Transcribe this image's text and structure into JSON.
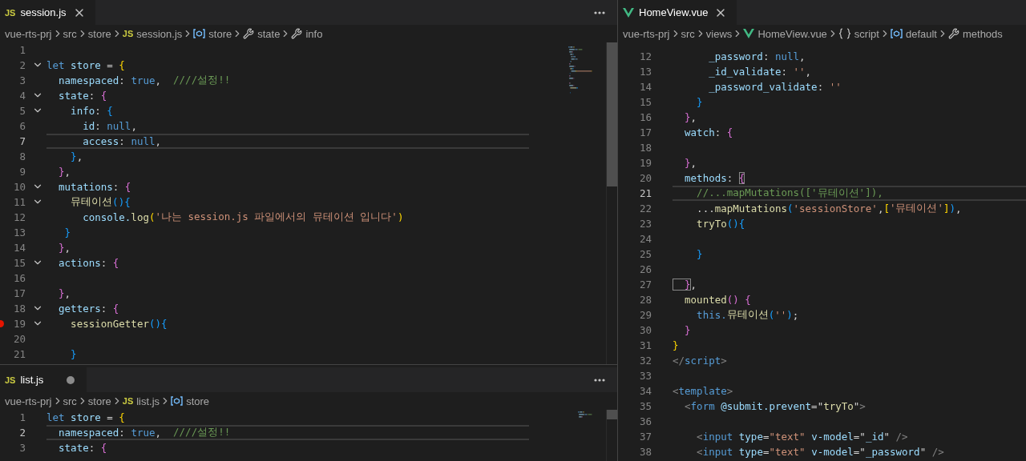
{
  "left_group": {
    "editors": [
      {
        "tab": {
          "label": "session.js",
          "kind": "js_file",
          "icon_text": "JS",
          "modified": false
        },
        "actions_menu": true,
        "minimap": true,
        "breadcrumbs": [
          {
            "label": "vue-rts-prj",
            "kind": "folder"
          },
          {
            "label": "src",
            "kind": "folder"
          },
          {
            "label": "store",
            "kind": "folder"
          },
          {
            "label": "session.js",
            "kind": "js_file",
            "icon_text": "JS"
          },
          {
            "label": "store",
            "kind": "variable"
          },
          {
            "label": "state",
            "kind": "property"
          },
          {
            "label": "info",
            "kind": "property"
          }
        ],
        "lines": [
          {
            "n": "1",
            "current": false,
            "fold": false,
            "breakpoint": false
          },
          {
            "n": "2",
            "current": false,
            "fold": true,
            "breakpoint": false,
            "tokens": [
              {
                "kind": "keyword",
                "text": "let"
              },
              {
                "kind": "variable",
                "text": " store"
              },
              {
                "kind": "punctuation",
                "text": " = "
              },
              {
                "kind": "brace1",
                "text": "{"
              }
            ]
          },
          {
            "n": "3",
            "current": false,
            "fold": false,
            "breakpoint": false,
            "tokens": [
              {
                "kind": "variable",
                "text": "  namespaced"
              },
              {
                "kind": "punctuation",
                "text": ": "
              },
              {
                "kind": "keyword",
                "text": "true"
              },
              {
                "kind": "punctuation",
                "text": ",  "
              },
              {
                "kind": "comment",
                "text": "////설정!!"
              }
            ]
          },
          {
            "n": "4",
            "current": false,
            "fold": true,
            "breakpoint": false,
            "tokens": [
              {
                "kind": "variable",
                "text": "  state"
              },
              {
                "kind": "punctuation",
                "text": ": "
              },
              {
                "kind": "brace2",
                "text": "{"
              }
            ]
          },
          {
            "n": "5",
            "current": false,
            "fold": true,
            "breakpoint": false,
            "tokens": [
              {
                "kind": "variable",
                "text": "    info"
              },
              {
                "kind": "punctuation",
                "text": ": "
              },
              {
                "kind": "brace3",
                "text": "{"
              }
            ]
          },
          {
            "n": "6",
            "current": false,
            "fold": false,
            "breakpoint": false,
            "tokens": [
              {
                "kind": "variable",
                "text": "      id"
              },
              {
                "kind": "punctuation",
                "text": ": "
              },
              {
                "kind": "keyword",
                "text": "null"
              },
              {
                "kind": "punctuation",
                "text": ","
              }
            ]
          },
          {
            "n": "7",
            "current": true,
            "fold": false,
            "breakpoint": false,
            "tokens": [
              {
                "kind": "variable",
                "text": "      access"
              },
              {
                "kind": "punctuation",
                "text": ": "
              },
              {
                "kind": "keyword",
                "text": "null"
              },
              {
                "kind": "punctuation",
                "text": ","
              }
            ]
          },
          {
            "n": "8",
            "current": false,
            "fold": false,
            "breakpoint": false,
            "tokens": [
              {
                "kind": "brace3",
                "text": "    }"
              },
              {
                "kind": "punctuation",
                "text": ","
              }
            ]
          },
          {
            "n": "9",
            "current": false,
            "fold": false,
            "breakpoint": false,
            "tokens": [
              {
                "kind": "brace2",
                "text": "  }"
              },
              {
                "kind": "punctuation",
                "text": ","
              }
            ]
          },
          {
            "n": "10",
            "current": false,
            "fold": true,
            "breakpoint": false,
            "tokens": [
              {
                "kind": "variable",
                "text": "  mutations"
              },
              {
                "kind": "punctuation",
                "text": ": "
              },
              {
                "kind": "brace2",
                "text": "{"
              }
            ]
          },
          {
            "n": "11",
            "current": false,
            "fold": true,
            "breakpoint": false,
            "tokens": [
              {
                "kind": "function",
                "text": "    뮤테이션"
              },
              {
                "kind": "brace3",
                "text": "(){"
              }
            ]
          },
          {
            "n": "12",
            "current": false,
            "fold": false,
            "breakpoint": false,
            "tokens": [
              {
                "kind": "variable",
                "text": "      console."
              },
              {
                "kind": "function",
                "text": "log"
              },
              {
                "kind": "brace1",
                "text": "("
              },
              {
                "kind": "string",
                "text": "'나는 session.js 파일에서의 뮤테이션 입니다'"
              },
              {
                "kind": "brace1",
                "text": ")"
              }
            ]
          },
          {
            "n": "13",
            "current": false,
            "fold": false,
            "breakpoint": false,
            "tokens": [
              {
                "kind": "brace3",
                "text": "   }"
              }
            ]
          },
          {
            "n": "14",
            "current": false,
            "fold": false,
            "breakpoint": false,
            "tokens": [
              {
                "kind": "brace2",
                "text": "  }"
              },
              {
                "kind": "punctuation",
                "text": ","
              }
            ]
          },
          {
            "n": "15",
            "current": false,
            "fold": true,
            "breakpoint": false,
            "tokens": [
              {
                "kind": "variable",
                "text": "  actions"
              },
              {
                "kind": "punctuation",
                "text": ": "
              },
              {
                "kind": "brace2",
                "text": "{"
              }
            ]
          },
          {
            "n": "16",
            "current": false,
            "fold": false,
            "breakpoint": false
          },
          {
            "n": "17",
            "current": false,
            "fold": false,
            "breakpoint": false,
            "tokens": [
              {
                "kind": "brace2",
                "text": "  }"
              },
              {
                "kind": "punctuation",
                "text": ","
              }
            ]
          },
          {
            "n": "18",
            "current": false,
            "fold": true,
            "breakpoint": false,
            "tokens": [
              {
                "kind": "variable",
                "text": "  getters"
              },
              {
                "kind": "punctuation",
                "text": ": "
              },
              {
                "kind": "brace2",
                "text": "{"
              }
            ]
          },
          {
            "n": "19",
            "current": false,
            "fold": true,
            "breakpoint": true,
            "tokens": [
              {
                "kind": "function",
                "text": "    sessionGetter"
              },
              {
                "kind": "brace3",
                "text": "(){"
              }
            ]
          },
          {
            "n": "20",
            "current": false,
            "fold": false,
            "breakpoint": false
          },
          {
            "n": "21",
            "current": false,
            "fold": false,
            "breakpoint": false,
            "tokens": [
              {
                "kind": "brace3",
                "text": "    }"
              }
            ]
          }
        ]
      },
      {
        "tab": {
          "label": "list.js",
          "kind": "js_file",
          "icon_text": "JS",
          "modified": true
        },
        "actions_menu": true,
        "minimap": true,
        "breadcrumbs": [
          {
            "label": "vue-rts-prj",
            "kind": "folder"
          },
          {
            "label": "src",
            "kind": "folder"
          },
          {
            "label": "store",
            "kind": "folder"
          },
          {
            "label": "list.js",
            "kind": "js_file",
            "icon_text": "JS"
          },
          {
            "label": "store",
            "kind": "variable"
          }
        ],
        "lines": [
          {
            "n": "1",
            "current": false,
            "fold": false,
            "breakpoint": false,
            "tokens": [
              {
                "kind": "keyword",
                "text": "let"
              },
              {
                "kind": "variable",
                "text": " store"
              },
              {
                "kind": "punctuation",
                "text": " = "
              },
              {
                "kind": "brace1",
                "text": "{"
              }
            ]
          },
          {
            "n": "2",
            "current": true,
            "fold": false,
            "breakpoint": false,
            "tokens": [
              {
                "kind": "variable",
                "text": "  namespaced"
              },
              {
                "kind": "punctuation",
                "text": ": "
              },
              {
                "kind": "keyword",
                "text": "true"
              },
              {
                "kind": "punctuation",
                "text": ",  "
              },
              {
                "kind": "comment",
                "text": "////설정!!"
              }
            ]
          },
          {
            "n": "3",
            "current": false,
            "fold": false,
            "breakpoint": false,
            "tokens": [
              {
                "kind": "variable",
                "text": "  state"
              },
              {
                "kind": "punctuation",
                "text": ": "
              },
              {
                "kind": "brace2",
                "text": "{"
              }
            ]
          }
        ]
      }
    ]
  },
  "right_group": {
    "editors": [
      {
        "tab": {
          "label": "HomeView.vue",
          "kind": "vue_file",
          "modified": false
        },
        "breadcrumbs": [
          {
            "label": "vue-rts-prj",
            "kind": "folder"
          },
          {
            "label": "src",
            "kind": "folder"
          },
          {
            "label": "views",
            "kind": "folder"
          },
          {
            "label": "HomeView.vue",
            "kind": "vue_file"
          },
          {
            "label": "script",
            "kind": "braces"
          },
          {
            "label": "default",
            "kind": "variable"
          },
          {
            "label": "methods",
            "kind": "property"
          }
        ],
        "lines": [
          {
            "n": "12",
            "current": false,
            "fold": false,
            "breakpoint": false,
            "tokens": [
              {
                "kind": "variable",
                "text": "      _password"
              },
              {
                "kind": "punctuation",
                "text": ": "
              },
              {
                "kind": "keyword",
                "text": "null"
              },
              {
                "kind": "punctuation",
                "text": ","
              }
            ]
          },
          {
            "n": "13",
            "current": false,
            "fold": false,
            "breakpoint": false,
            "tokens": [
              {
                "kind": "variable",
                "text": "      _id_validate"
              },
              {
                "kind": "punctuation",
                "text": ": "
              },
              {
                "kind": "string",
                "text": "''"
              },
              {
                "kind": "punctuation",
                "text": ","
              }
            ]
          },
          {
            "n": "14",
            "current": false,
            "fold": false,
            "breakpoint": false,
            "tokens": [
              {
                "kind": "variable",
                "text": "      _password_validate"
              },
              {
                "kind": "punctuation",
                "text": ": "
              },
              {
                "kind": "string",
                "text": "''"
              }
            ]
          },
          {
            "n": "15",
            "current": false,
            "fold": false,
            "breakpoint": false,
            "tokens": [
              {
                "kind": "brace3",
                "text": "    }"
              }
            ]
          },
          {
            "n": "16",
            "current": false,
            "fold": false,
            "breakpoint": false,
            "tokens": [
              {
                "kind": "brace2",
                "text": "  }"
              },
              {
                "kind": "punctuation",
                "text": ","
              }
            ]
          },
          {
            "n": "17",
            "current": false,
            "fold": false,
            "breakpoint": false,
            "tokens": [
              {
                "kind": "variable",
                "text": "  watch"
              },
              {
                "kind": "punctuation",
                "text": ": "
              },
              {
                "kind": "brace2",
                "text": "{"
              }
            ]
          },
          {
            "n": "18",
            "current": false,
            "fold": false,
            "breakpoint": false
          },
          {
            "n": "19",
            "current": false,
            "fold": false,
            "breakpoint": false,
            "tokens": [
              {
                "kind": "brace2",
                "text": "  }"
              },
              {
                "kind": "punctuation",
                "text": ","
              }
            ]
          },
          {
            "n": "20",
            "current": false,
            "fold": false,
            "breakpoint": false,
            "tokens": [
              {
                "kind": "variable",
                "text": "  methods"
              },
              {
                "kind": "punctuation",
                "text": ": "
              },
              {
                "kind": "brace2_matched",
                "text": "{"
              }
            ]
          },
          {
            "n": "21",
            "current": true,
            "fold": false,
            "breakpoint": false,
            "tokens": [
              {
                "kind": "comment",
                "text": "    //...mapMutations(['뮤테이션']),"
              }
            ]
          },
          {
            "n": "22",
            "current": false,
            "fold": false,
            "breakpoint": false,
            "tokens": [
              {
                "kind": "punctuation",
                "text": "    ..."
              },
              {
                "kind": "function",
                "text": "mapMutations"
              },
              {
                "kind": "brace3",
                "text": "("
              },
              {
                "kind": "string",
                "text": "'sessionStore'"
              },
              {
                "kind": "punctuation",
                "text": ","
              },
              {
                "kind": "brace1",
                "text": "["
              },
              {
                "kind": "string",
                "text": "'뮤테이션'"
              },
              {
                "kind": "brace1",
                "text": "]"
              },
              {
                "kind": "brace3",
                "text": ")"
              },
              {
                "kind": "punctuation",
                "text": ","
              }
            ]
          },
          {
            "n": "23",
            "current": false,
            "fold": false,
            "breakpoint": false,
            "tokens": [
              {
                "kind": "function",
                "text": "    tryTo"
              },
              {
                "kind": "brace3",
                "text": "(){"
              }
            ]
          },
          {
            "n": "24",
            "current": false,
            "fold": false,
            "breakpoint": false
          },
          {
            "n": "25",
            "current": false,
            "fold": false,
            "breakpoint": false,
            "tokens": [
              {
                "kind": "brace3",
                "text": "    }"
              }
            ]
          },
          {
            "n": "26",
            "current": false,
            "fold": false,
            "breakpoint": false
          },
          {
            "n": "27",
            "current": false,
            "fold": false,
            "breakpoint": false,
            "tokens": [
              {
                "kind": "brace2_matched",
                "text": "  }"
              },
              {
                "kind": "punctuation",
                "text": ","
              }
            ]
          },
          {
            "n": "28",
            "current": false,
            "fold": false,
            "breakpoint": false,
            "tokens": [
              {
                "kind": "function",
                "text": "  mounted"
              },
              {
                "kind": "brace2",
                "text": "() {"
              }
            ]
          },
          {
            "n": "29",
            "current": false,
            "fold": false,
            "breakpoint": false,
            "tokens": [
              {
                "kind": "keyword",
                "text": "    this."
              },
              {
                "kind": "function",
                "text": "뮤테이션"
              },
              {
                "kind": "brace3",
                "text": "("
              },
              {
                "kind": "string",
                "text": "''"
              },
              {
                "kind": "brace3",
                "text": ")"
              },
              {
                "kind": "punctuation",
                "text": ";"
              }
            ]
          },
          {
            "n": "30",
            "current": false,
            "fold": false,
            "breakpoint": false,
            "tokens": [
              {
                "kind": "brace2",
                "text": "  }"
              }
            ]
          },
          {
            "n": "31",
            "current": false,
            "fold": false,
            "breakpoint": false,
            "tokens": [
              {
                "kind": "brace1",
                "text": "}"
              }
            ]
          },
          {
            "n": "32",
            "current": false,
            "fold": false,
            "breakpoint": false,
            "tokens": [
              {
                "kind": "tag",
                "text": "</"
              },
              {
                "kind": "tag_name",
                "text": "script"
              },
              {
                "kind": "tag",
                "text": ">"
              }
            ]
          },
          {
            "n": "33",
            "current": false,
            "fold": false,
            "breakpoint": false
          },
          {
            "n": "34",
            "current": false,
            "fold": false,
            "breakpoint": false,
            "tokens": [
              {
                "kind": "tag",
                "text": "<"
              },
              {
                "kind": "tag_name",
                "text": "template"
              },
              {
                "kind": "tag",
                "text": ">"
              }
            ]
          },
          {
            "n": "35",
            "current": false,
            "fold": false,
            "breakpoint": false,
            "tokens": [
              {
                "kind": "tag",
                "text": "  <"
              },
              {
                "kind": "tag_name",
                "text": "form"
              },
              {
                "kind": "attribute",
                "text": " @submit.prevent"
              },
              {
                "kind": "punctuation",
                "text": "=\""
              },
              {
                "kind": "function",
                "text": "tryTo"
              },
              {
                "kind": "punctuation",
                "text": "\""
              },
              {
                "kind": "tag",
                "text": ">"
              }
            ]
          },
          {
            "n": "36",
            "current": false,
            "fold": false,
            "breakpoint": false
          },
          {
            "n": "37",
            "current": false,
            "fold": false,
            "breakpoint": false,
            "tokens": [
              {
                "kind": "tag",
                "text": "    <"
              },
              {
                "kind": "tag_name",
                "text": "input"
              },
              {
                "kind": "attribute",
                "text": " type"
              },
              {
                "kind": "punctuation",
                "text": "="
              },
              {
                "kind": "string",
                "text": "\"text\""
              },
              {
                "kind": "attribute",
                "text": " v-model"
              },
              {
                "kind": "punctuation",
                "text": "=\""
              },
              {
                "kind": "variable",
                "text": "_id"
              },
              {
                "kind": "punctuation",
                "text": "\""
              },
              {
                "kind": "tag",
                "text": " />"
              }
            ]
          },
          {
            "n": "38",
            "current": false,
            "fold": false,
            "breakpoint": false,
            "tokens": [
              {
                "kind": "tag",
                "text": "    <"
              },
              {
                "kind": "tag_name",
                "text": "input"
              },
              {
                "kind": "attribute",
                "text": " type"
              },
              {
                "kind": "punctuation",
                "text": "="
              },
              {
                "kind": "string",
                "text": "\"text\""
              },
              {
                "kind": "attribute",
                "text": " v-model"
              },
              {
                "kind": "punctuation",
                "text": "=\""
              },
              {
                "kind": "variable",
                "text": "_password"
              },
              {
                "kind": "punctuation",
                "text": "\""
              },
              {
                "kind": "tag",
                "text": " />"
              }
            ]
          }
        ]
      }
    ]
  }
}
